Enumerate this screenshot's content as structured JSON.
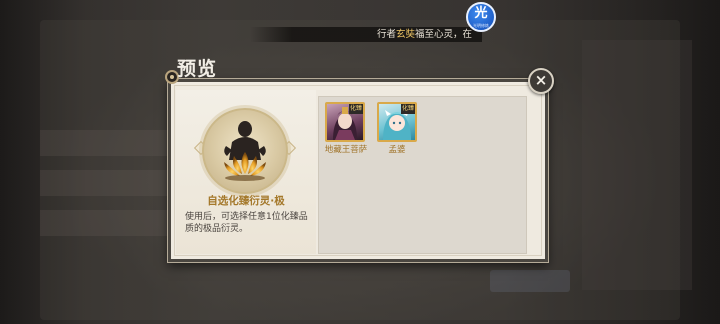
{
  "marquee": {
    "prefix": "行者",
    "highlight": "玄奘",
    "suffix": "福至心灵，在"
  },
  "marquee_badge": {
    "glyph": "光",
    "subtext": "光明修炼"
  },
  "dialog": {
    "title": "预览",
    "close_icon": "×"
  },
  "item": {
    "name": "自选化臻衍灵·极",
    "description": "使用后，可选择任意1位化臻品质的极品衍灵。"
  },
  "heroes": [
    {
      "name": "地藏王菩萨",
      "badge": "化臻"
    },
    {
      "name": "孟婆",
      "badge": "化臻"
    }
  ],
  "colors": {
    "gold_text": "#a4782a",
    "dialog_bg": "#efeae0",
    "badge_blue": "#1f5fc8"
  }
}
